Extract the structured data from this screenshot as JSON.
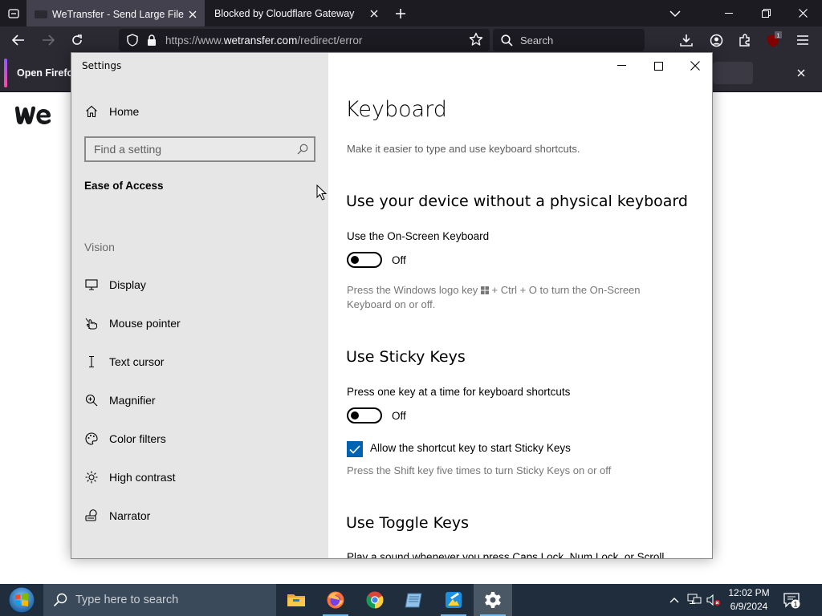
{
  "browser": {
    "tabs": [
      {
        "title": "WeTransfer - Send Large Files &",
        "active": true
      },
      {
        "title": "Blocked by Cloudflare Gateway",
        "active": false
      }
    ],
    "url_prefix": "https://www.",
    "url_domain": "wetransfer.com",
    "url_path": "/redirect/error",
    "search_placeholder": "Search",
    "extension_badge": "1",
    "notification_text": "Open Firefo"
  },
  "page": {
    "logo_text": "we"
  },
  "settings": {
    "window_title": "Settings",
    "sidebar": {
      "home_label": "Home",
      "search_placeholder": "Find a setting",
      "category": "Ease of Access",
      "group_label": "Vision",
      "items": [
        {
          "label": "Display",
          "icon": "display-icon"
        },
        {
          "label": "Mouse pointer",
          "icon": "mouse-pointer-icon"
        },
        {
          "label": "Text cursor",
          "icon": "text-cursor-icon"
        },
        {
          "label": "Magnifier",
          "icon": "magnifier-icon"
        },
        {
          "label": "Color filters",
          "icon": "palette-icon"
        },
        {
          "label": "High contrast",
          "icon": "brightness-icon"
        },
        {
          "label": "Narrator",
          "icon": "narrator-icon"
        }
      ]
    },
    "content": {
      "title": "Keyboard",
      "description": "Make it easier to type and use keyboard shortcuts.",
      "sections": {
        "onscreen": {
          "heading": "Use your device without a physical keyboard",
          "label": "Use the On-Screen Keyboard",
          "toggle_state": "Off",
          "help_before": "Press the Windows logo key",
          "help_after": "+ Ctrl + O to turn the On-Screen Keyboard on or off."
        },
        "sticky": {
          "heading": "Use Sticky Keys",
          "label": "Press one key at a time for keyboard shortcuts",
          "toggle_state": "Off",
          "checkbox_label": "Allow the shortcut key to start Sticky Keys",
          "checkbox_checked": true,
          "help": "Press the Shift key five times to turn Sticky Keys on or off"
        },
        "toggle": {
          "heading": "Use Toggle Keys",
          "partial_text": "Play a sound whenever you press Caps Lock, Num Lock, or Scroll"
        }
      }
    }
  },
  "taskbar": {
    "search_placeholder": "Type here to search",
    "time": "12:02 PM",
    "date": "6/9/2024",
    "notification_count": "1"
  },
  "colors": {
    "accent_blue": "#0063b1",
    "browser_dark": "#1c1b22",
    "taskbar": "#1f2d3d"
  }
}
